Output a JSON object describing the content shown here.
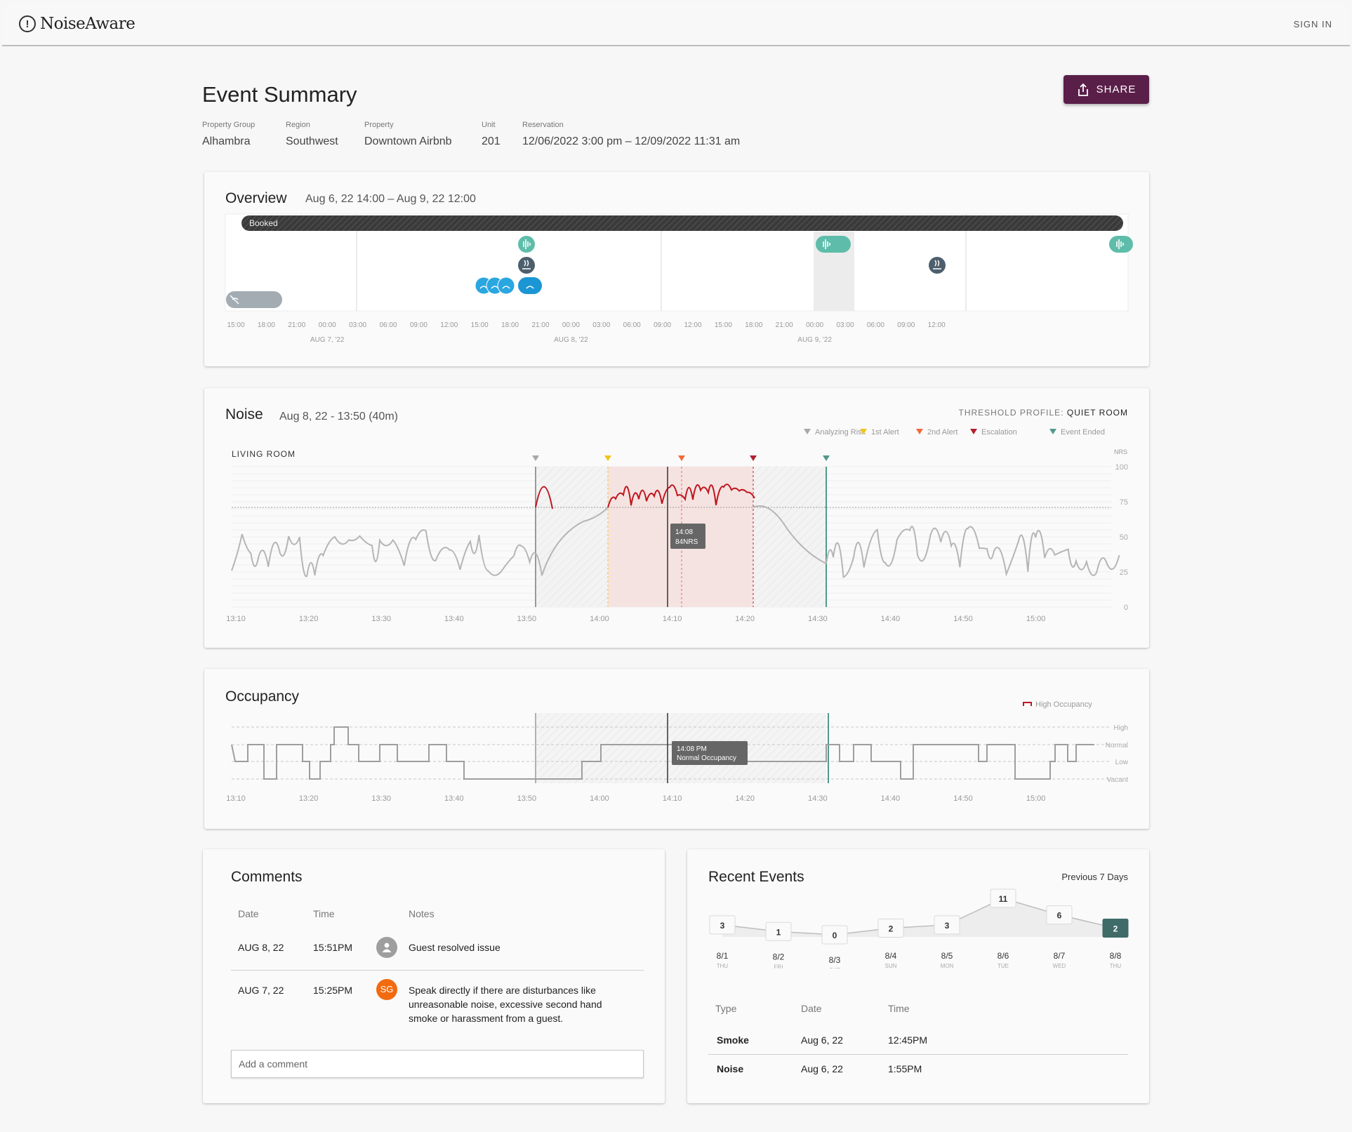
{
  "app": {
    "brand": "NoiseAware",
    "sign_in": "SIGN IN"
  },
  "page": {
    "title": "Event Summary",
    "share_label": "SHARE"
  },
  "meta": [
    {
      "key": "Property Group",
      "value": "Alhambra"
    },
    {
      "key": "Region",
      "value": "Southwest"
    },
    {
      "key": "Property",
      "value": "Downtown Airbnb"
    },
    {
      "key": "Unit",
      "value": "201"
    },
    {
      "key": "Reservation",
      "value": "12/06/2022 3:00 pm – 12/09/2022 11:31 am"
    }
  ],
  "overview": {
    "title": "Overview",
    "range": "Aug 6, 22 14:00 – Aug 9, 22 12:00",
    "booked_label": "Booked",
    "time_ticks": [
      "15:00",
      "18:00",
      "21:00",
      "00:00",
      "03:00",
      "06:00",
      "09:00",
      "12:00",
      "15:00",
      "18:00",
      "21:00",
      "00:00",
      "03:00",
      "06:00",
      "09:00",
      "12:00",
      "15:00",
      "18:00",
      "21:00",
      "00:00",
      "03:00",
      "06:00",
      "09:00",
      "12:00"
    ],
    "date_labels": [
      "AUG 7, '22",
      "AUG 8, '22",
      "AUG 9, '22"
    ]
  },
  "noise": {
    "title": "Noise",
    "range": "Aug 8, 22 - 13:50 (40m)",
    "threshold_label": "THRESHOLD PROFILE:",
    "threshold_value": "QUIET ROOM",
    "legend": [
      {
        "label": "Analyzing Risk",
        "color": "#a8a8a8"
      },
      {
        "label": "1st Alert",
        "color": "#f0c419"
      },
      {
        "label": "2nd Alert",
        "color": "#f2693a"
      },
      {
        "label": "Escalation",
        "color": "#b3202f"
      },
      {
        "label": "Event Ended",
        "color": "#4f9a8b"
      }
    ],
    "room_label": "LIVING ROOM",
    "y_unit": "NRS",
    "y_ticks": [
      "100",
      "75",
      "50",
      "25",
      "0"
    ],
    "x_ticks": [
      "13:10",
      "13:20",
      "13:30",
      "13:40",
      "13:50",
      "14:00",
      "14:10",
      "14:20",
      "14:30",
      "14:40",
      "14:50",
      "15:00"
    ],
    "tooltip_time": "14:08",
    "tooltip_value": "84NRS"
  },
  "occupancy": {
    "title": "Occupancy",
    "legend_label": "High Occupancy",
    "levels": [
      "High",
      "Normal",
      "Low",
      "Vacant"
    ],
    "x_ticks": [
      "13:10",
      "13:20",
      "13:30",
      "13:40",
      "13:50",
      "14:00",
      "14:10",
      "14:20",
      "14:30",
      "14:40",
      "14:50",
      "15:00"
    ],
    "tooltip_time": "14:08 PM",
    "tooltip_value": "Normal Occupancy"
  },
  "comments": {
    "title": "Comments",
    "headers": [
      "Date",
      "Time",
      "Notes"
    ],
    "rows": [
      {
        "date": "AUG 8, 22",
        "time": "15:51PM",
        "avatar": "",
        "note": "Guest resolved issue"
      },
      {
        "date": "AUG 7, 22",
        "time": "15:25PM",
        "avatar": "SG",
        "note": "Speak directly if there are disturbances like unreasonable noise, excessive second hand smoke or harassment from a guest."
      }
    ],
    "input_placeholder": "Add a comment"
  },
  "recent": {
    "title": "Recent Events",
    "period": "Previous 7 Days",
    "chart_data": {
      "type": "line",
      "categories": [
        "8/1",
        "8/2",
        "8/3",
        "8/4",
        "8/5",
        "8/6",
        "8/7",
        "8/8"
      ],
      "weekdays": [
        "THU",
        "FRI",
        "SAT",
        "SUN",
        "MON",
        "TUE",
        "WED",
        "THU"
      ],
      "values": [
        3,
        1,
        0,
        2,
        3,
        11,
        6,
        2
      ],
      "highlight_index": 7
    },
    "headers": [
      "Type",
      "Date",
      "Time"
    ],
    "rows": [
      {
        "type": "Smoke",
        "date": "Aug 6, 22",
        "time": "12:45PM"
      },
      {
        "type": "Noise",
        "date": "Aug 6, 22",
        "time": "1:55PM"
      }
    ]
  }
}
